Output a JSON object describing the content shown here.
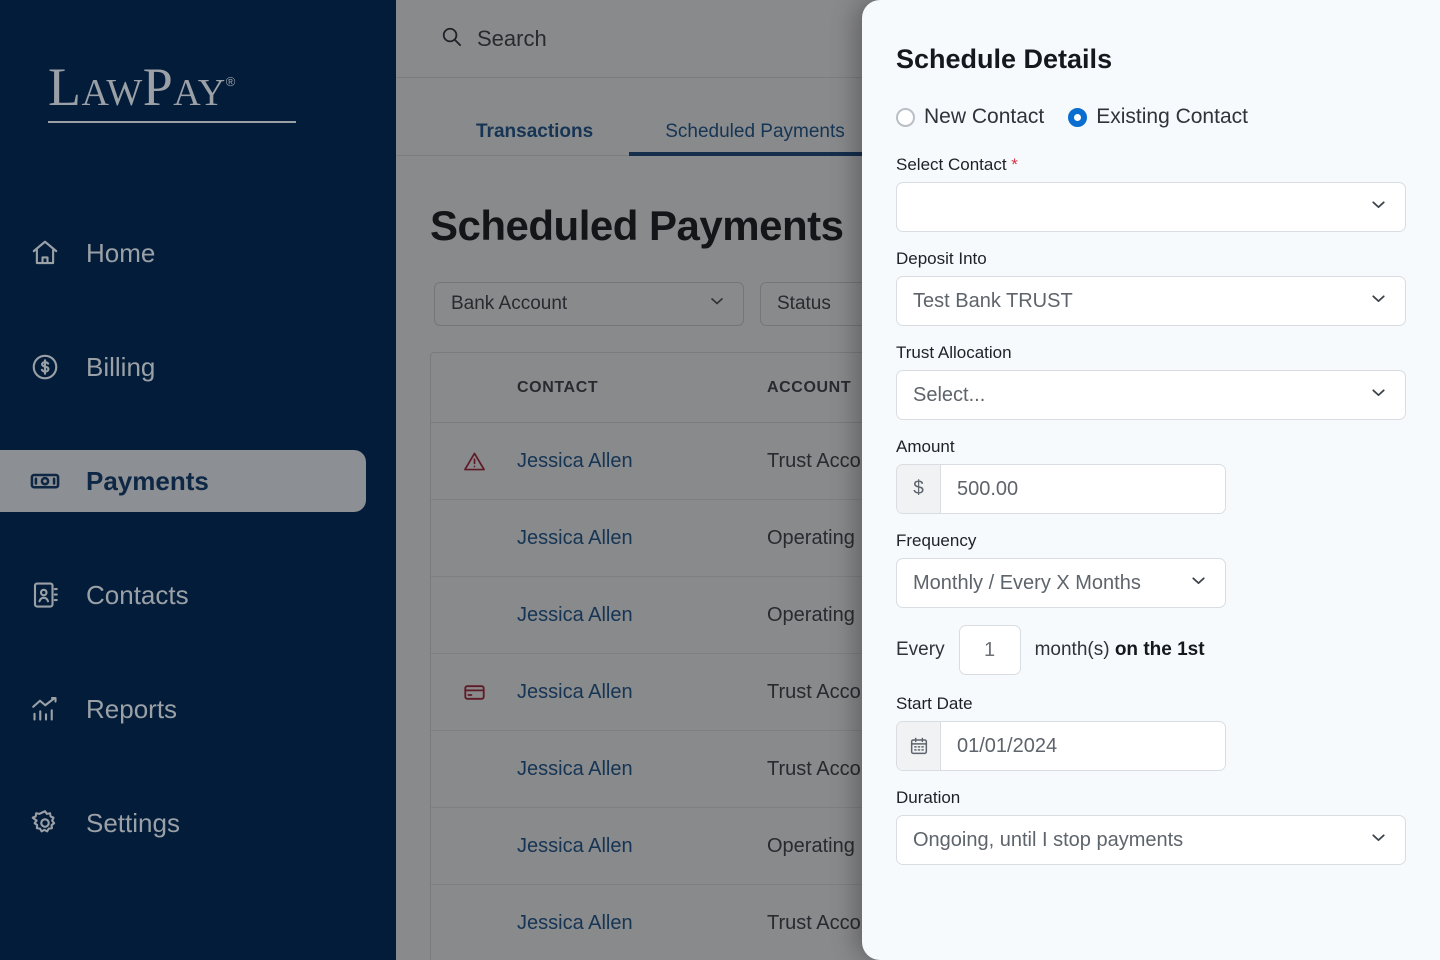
{
  "sidebar": {
    "logo": {
      "text": "LawPay",
      "registered": "®"
    },
    "items": [
      {
        "label": "Home",
        "icon": "home-icon",
        "active": false
      },
      {
        "label": "Billing",
        "icon": "dollar-circle-icon",
        "active": false
      },
      {
        "label": "Payments",
        "icon": "banknote-icon",
        "active": true
      },
      {
        "label": "Contacts",
        "icon": "address-book-icon",
        "active": false
      },
      {
        "label": "Reports",
        "icon": "chart-icon",
        "active": false
      },
      {
        "label": "Settings",
        "icon": "gear-icon",
        "active": false
      }
    ]
  },
  "topbar": {
    "search_placeholder": "Search",
    "search_value": "",
    "search_icon": "search-icon"
  },
  "tabs": [
    {
      "label": "Transactions",
      "active": false
    },
    {
      "label": "Scheduled Payments",
      "active": true
    }
  ],
  "main": {
    "page_title": "Scheduled Payments",
    "filters": [
      {
        "label": "Bank Account",
        "icon": "chevron-down-icon"
      },
      {
        "label": "Status",
        "icon": "chevron-down-icon"
      }
    ],
    "table": {
      "columns": [
        "",
        "CONTACT",
        "ACCOUNT"
      ],
      "rows": [
        {
          "icon": "warning-triangle-icon",
          "contact": "Jessica Allen",
          "account": "Trust Acco"
        },
        {
          "icon": "",
          "contact": "Jessica Allen",
          "account": "Operating"
        },
        {
          "icon": "",
          "contact": "Jessica Allen",
          "account": "Operating"
        },
        {
          "icon": "credit-card-icon",
          "contact": "Jessica Allen",
          "account": "Trust Acco"
        },
        {
          "icon": "",
          "contact": "Jessica Allen",
          "account": "Trust Acco"
        },
        {
          "icon": "",
          "contact": "Jessica Allen",
          "account": "Operating"
        },
        {
          "icon": "",
          "contact": "Jessica Allen",
          "account": "Trust Acco"
        }
      ]
    }
  },
  "panel": {
    "title": "Schedule Details",
    "contact_type": {
      "options": [
        {
          "label": "New Contact",
          "selected": false
        },
        {
          "label": "Existing Contact",
          "selected": true
        }
      ]
    },
    "select_contact": {
      "label": "Select Contact",
      "required_marker": "*",
      "value": "",
      "icon": "chevron-down-icon"
    },
    "deposit_into": {
      "label": "Deposit Into",
      "value": "Test Bank TRUST",
      "icon": "chevron-down-icon"
    },
    "trust_allocation": {
      "label": "Trust Allocation",
      "value": "Select...",
      "icon": "chevron-down-icon"
    },
    "amount": {
      "label": "Amount",
      "currency_symbol": "$",
      "value": "500.00"
    },
    "frequency": {
      "label": "Frequency",
      "value": "Monthly / Every X Months",
      "icon": "chevron-down-icon"
    },
    "every": {
      "prefix": "Every",
      "value": "1",
      "unit": "month(s)",
      "detail": "on the 1st"
    },
    "start_date": {
      "label": "Start Date",
      "value": "01/01/2024",
      "icon": "calendar-icon"
    },
    "duration": {
      "label": "Duration",
      "value": "Ongoing, until I stop payments",
      "icon": "chevron-down-icon"
    }
  },
  "colors": {
    "sidebar_bg": "#021c39",
    "sidebar_text": "#9aa0a6",
    "active_pill_bg": "#8c8f93",
    "link_blue": "#18548f",
    "tab_underline": "#16467f",
    "radio_blue": "#0a6ed1",
    "required_red": "#d6354a",
    "alert_red": "#a91f32",
    "panel_bg": "#f6fafd"
  }
}
